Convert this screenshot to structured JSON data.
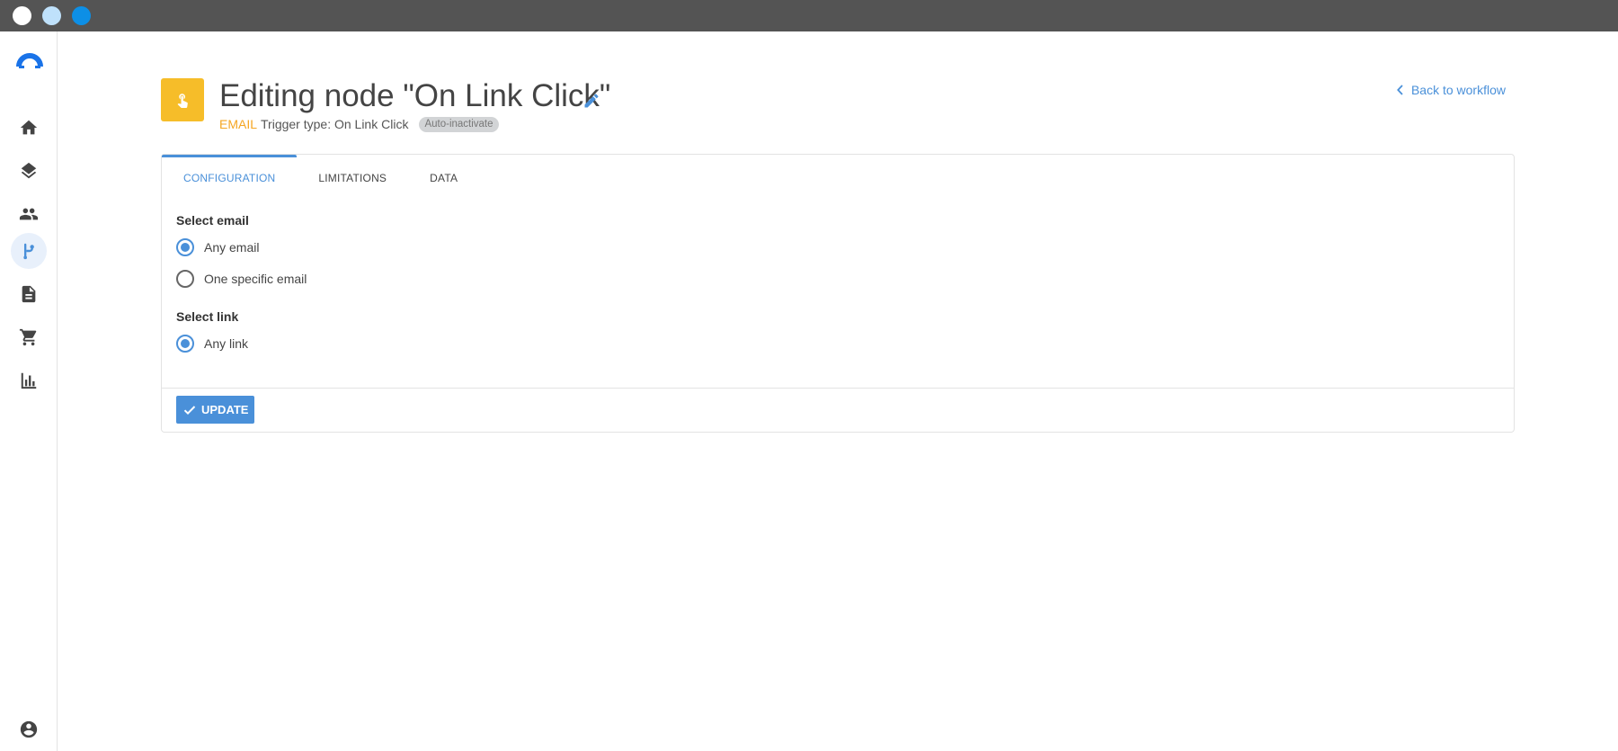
{
  "window": {
    "controls": [
      "close",
      "minimize",
      "maximize"
    ]
  },
  "sidebar": {
    "items": [
      {
        "icon": "home-icon",
        "active": false
      },
      {
        "icon": "layers-icon",
        "active": false
      },
      {
        "icon": "people-icon",
        "active": false
      },
      {
        "icon": "workflow-icon",
        "active": true
      },
      {
        "icon": "document-icon",
        "active": false
      },
      {
        "icon": "cart-icon",
        "active": false
      },
      {
        "icon": "bar-chart-icon",
        "active": false
      }
    ],
    "bottom_icon": "account-icon"
  },
  "header": {
    "title": "Editing node \"On Link Click\"",
    "channel": "EMAIL",
    "trigger_type": "Trigger type: On Link Click",
    "badge": "Auto-inactivate",
    "back_link": "Back to workflow"
  },
  "tabs": [
    {
      "label": "CONFIGURATION",
      "active": true
    },
    {
      "label": "LIMITATIONS",
      "active": false
    },
    {
      "label": "DATA",
      "active": false
    }
  ],
  "form": {
    "select_email": {
      "label": "Select email",
      "options": [
        {
          "label": "Any email",
          "checked": true
        },
        {
          "label": "One specific email",
          "checked": false
        }
      ]
    },
    "select_link": {
      "label": "Select link",
      "options": [
        {
          "label": "Any link",
          "checked": true
        }
      ]
    }
  },
  "footer": {
    "update_label": "UPDATE"
  },
  "colors": {
    "accent": "#4a90d9",
    "node_badge": "#f6bd29",
    "channel": "#f5a623",
    "titlebar": "#545454"
  }
}
